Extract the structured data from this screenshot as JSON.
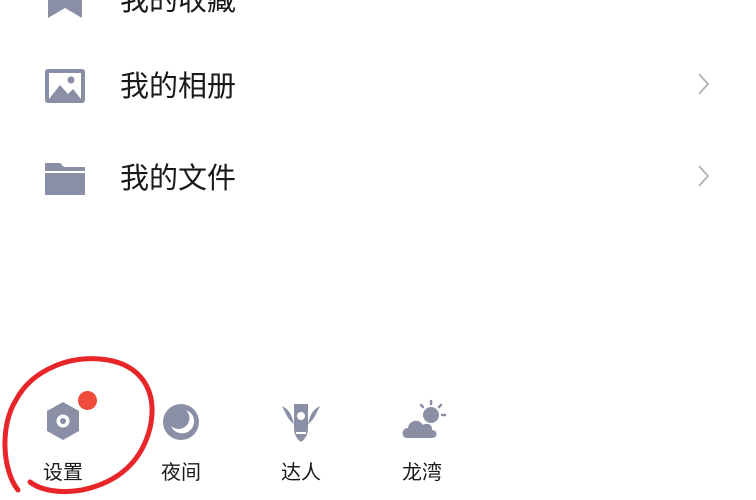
{
  "menu": {
    "items": [
      {
        "label": "我的收藏",
        "icon": "star-icon"
      },
      {
        "label": "我的相册",
        "icon": "image-icon"
      },
      {
        "label": "我的文件",
        "icon": "folder-icon"
      }
    ]
  },
  "bottom_bar": {
    "items": [
      {
        "label": "设置",
        "icon": "gear-icon"
      },
      {
        "label": "夜间",
        "icon": "moon-icon"
      },
      {
        "label": "达人",
        "icon": "wing-badge-icon"
      },
      {
        "label": "龙湾",
        "icon": "weather-icon"
      }
    ]
  },
  "colors": {
    "icon_gray": "#8a8fa6",
    "chevron_gray": "#b5b5bb",
    "badge_red": "#ef4b3c",
    "annotation_red": "#e8262a",
    "text": "#1a1a1a"
  }
}
